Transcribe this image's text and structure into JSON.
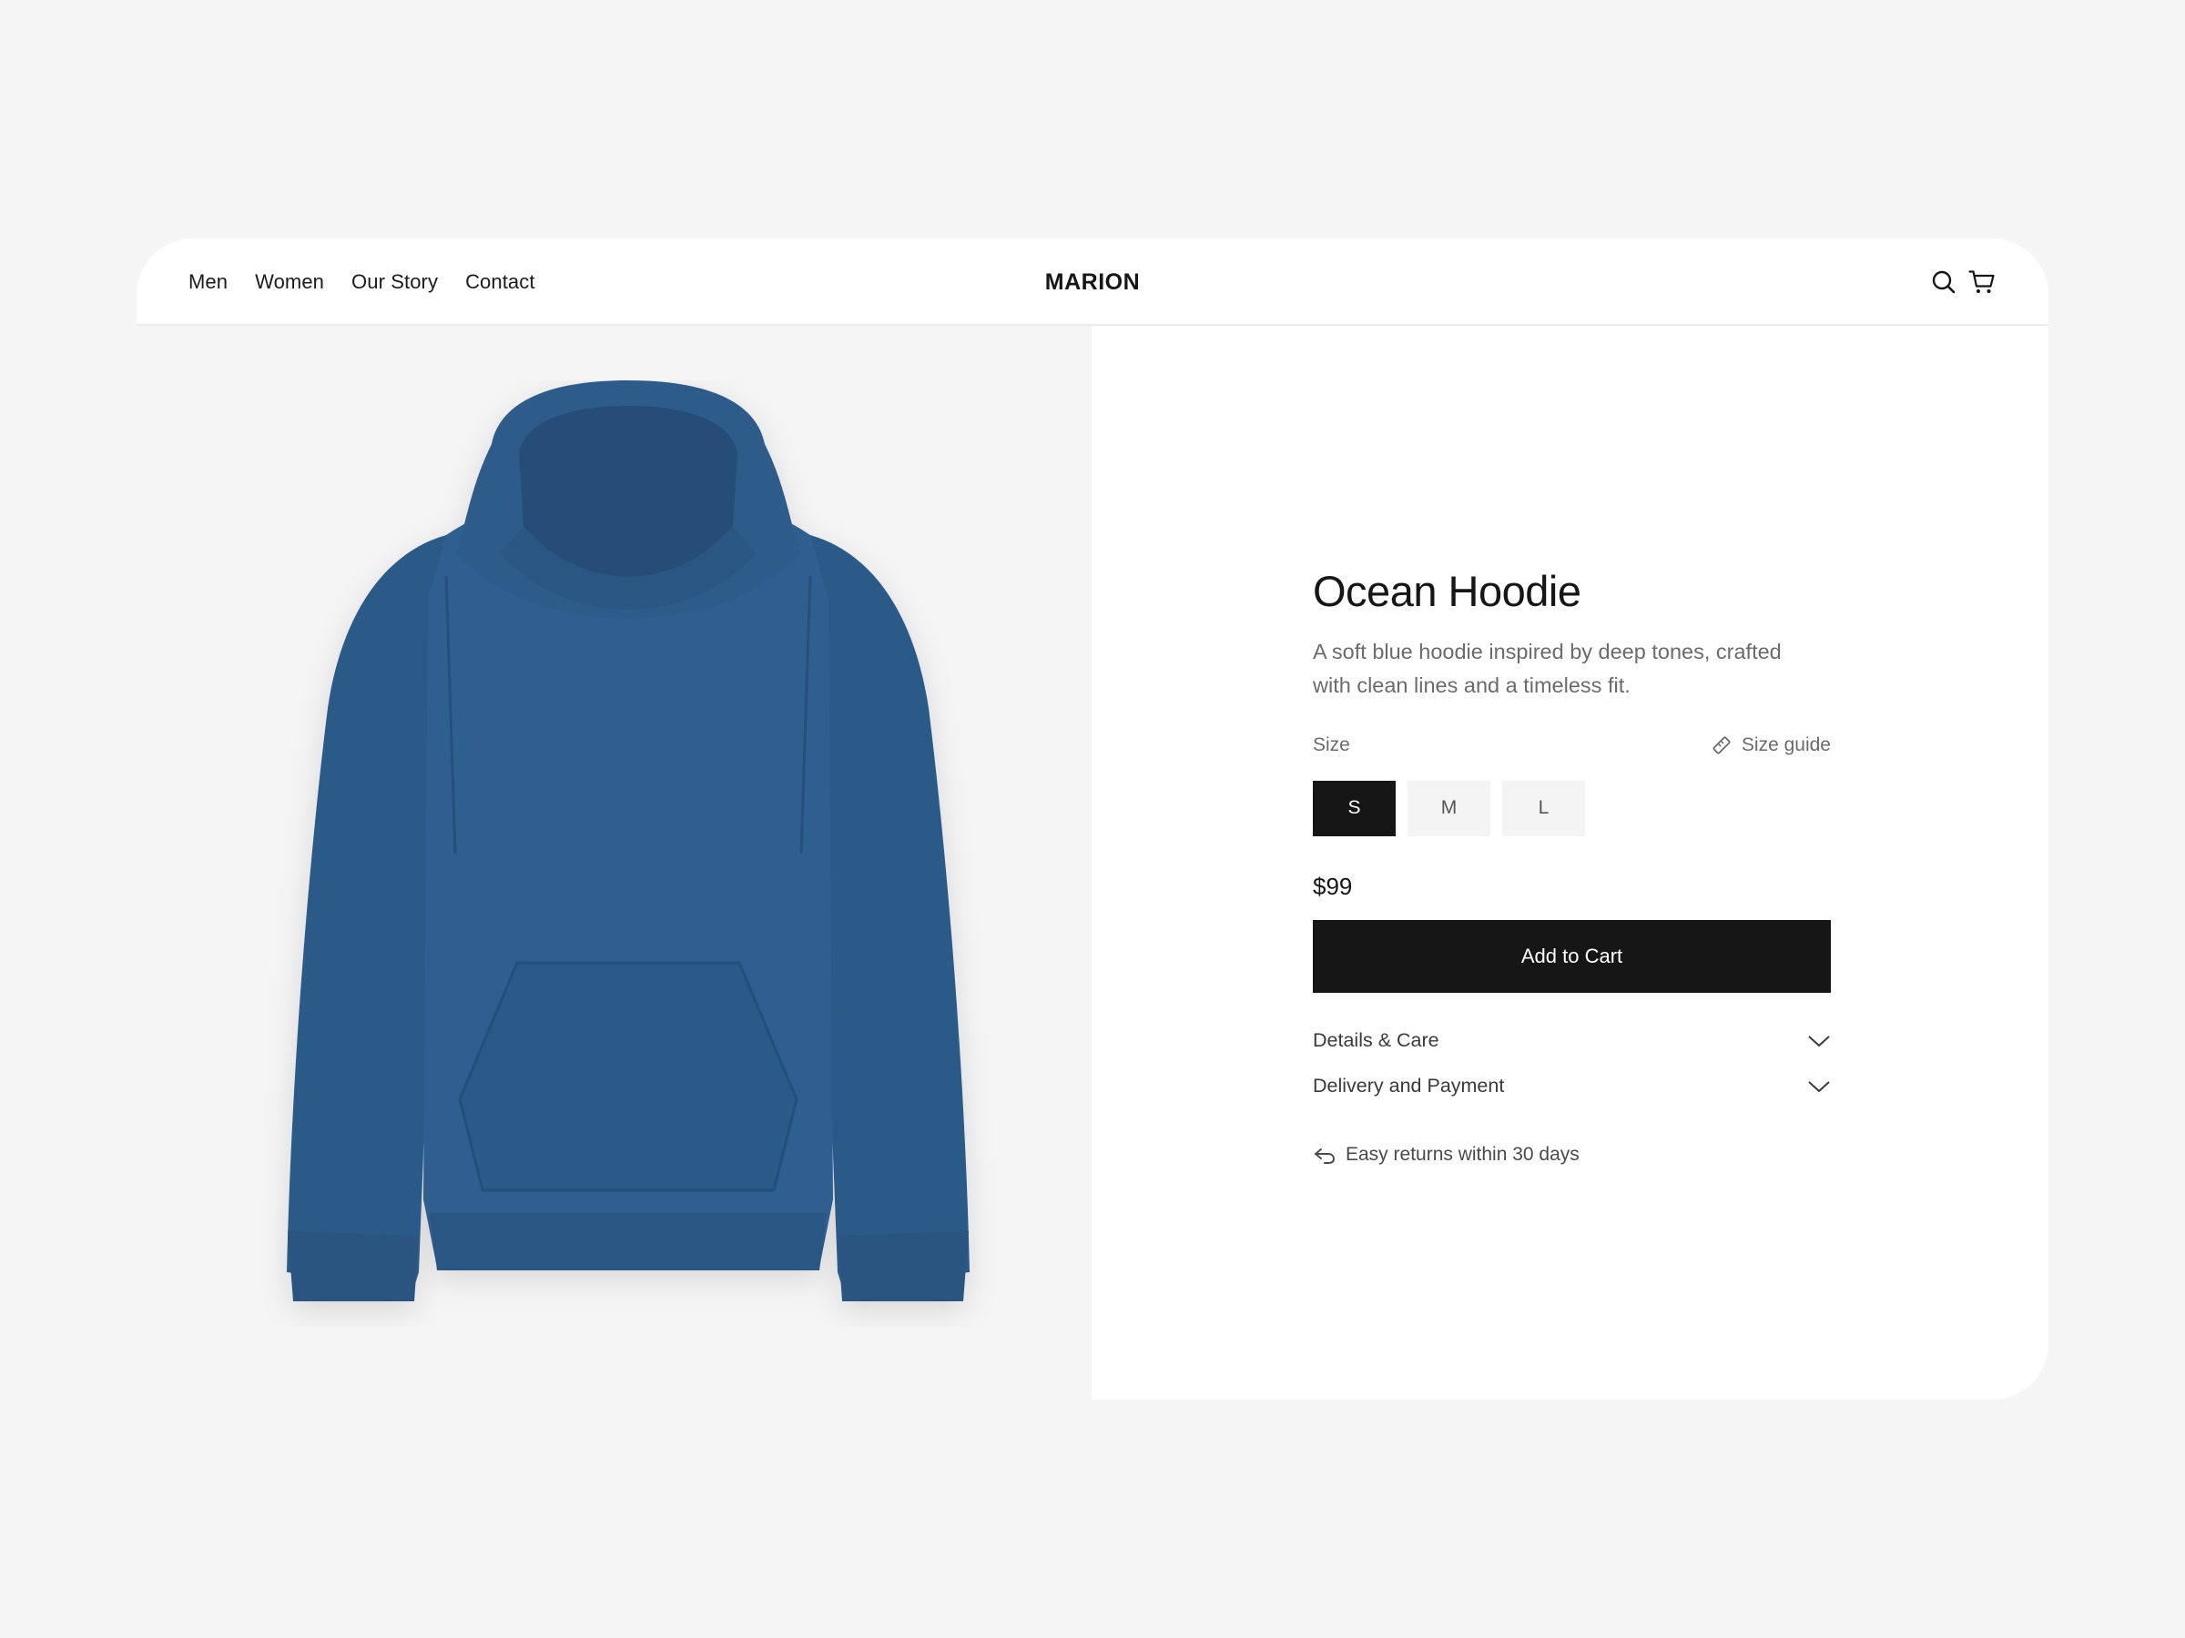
{
  "nav": {
    "items": [
      {
        "label": "Men"
      },
      {
        "label": "Women"
      },
      {
        "label": "Our Story"
      },
      {
        "label": "Contact"
      }
    ]
  },
  "brand": {
    "name": "MARION"
  },
  "header_icons": {
    "search": "search-icon",
    "cart": "cart-icon"
  },
  "product": {
    "title": "Ocean Hoodie",
    "description": "A soft blue hoodie inspired by deep tones, crafted with clean lines and a timeless fit.",
    "size_label": "Size",
    "size_guide_label": "Size guide",
    "sizes": [
      {
        "label": "S",
        "selected": true
      },
      {
        "label": "M",
        "selected": false
      },
      {
        "label": "L",
        "selected": false
      }
    ],
    "price": "$99",
    "add_to_cart_label": "Add to Cart",
    "accordion": [
      {
        "label": "Details & Care"
      },
      {
        "label": "Delivery and Payment"
      }
    ],
    "returns_note": "Easy returns within 30 days"
  },
  "colors": {
    "background": "#f5f5f5",
    "card": "#ffffff",
    "primary": "#161616",
    "muted_text": "#6b6b6b",
    "hoodie": "#2f5f8e"
  }
}
